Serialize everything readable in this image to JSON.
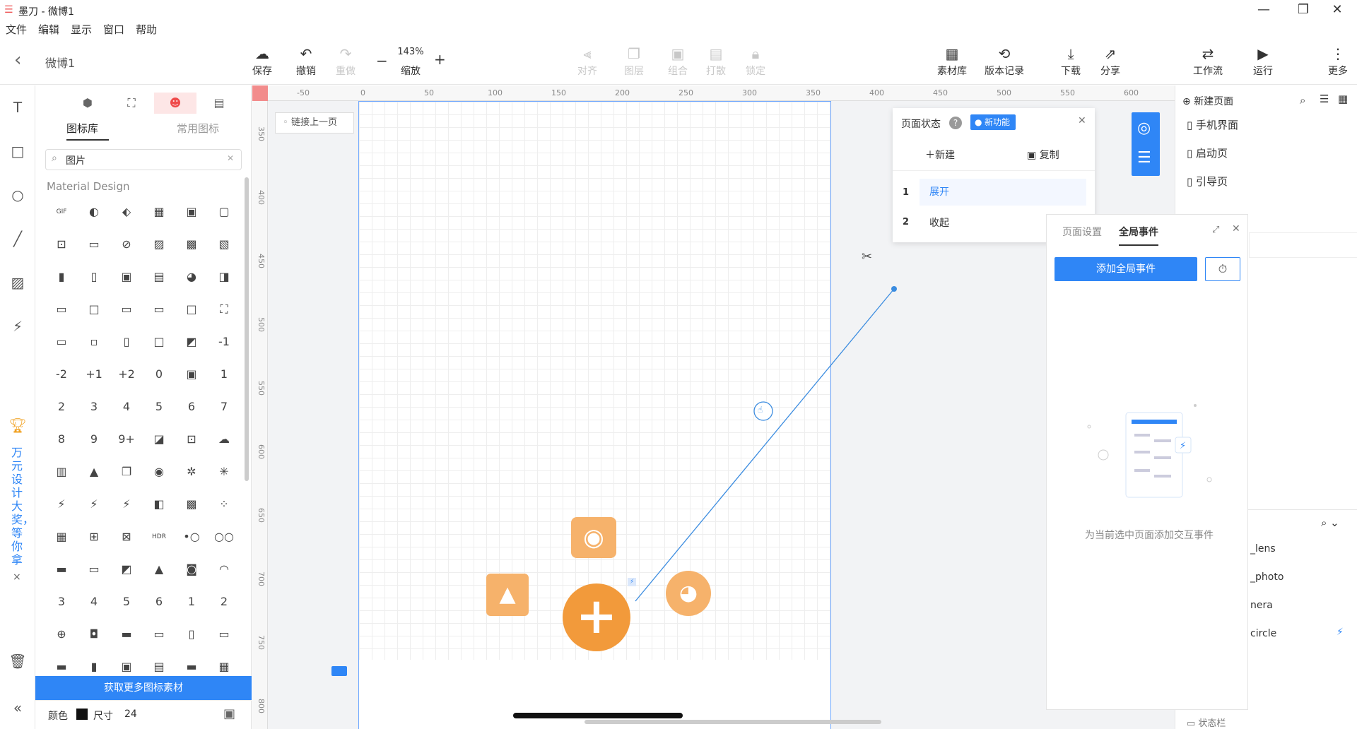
{
  "title_bar": {
    "title": "墨刀 - 微博1",
    "minimize": "—",
    "restore": "❐",
    "close": "✕"
  },
  "menu": [
    "文件",
    "编辑",
    "显示",
    "窗口",
    "帮助"
  ],
  "header": {
    "back": "‹",
    "doc_name": "微博1"
  },
  "toolbar": {
    "save": "保存",
    "undo": "撤销",
    "redo": "重做",
    "zoom_minus": "−",
    "zoom_value": "143%",
    "zoom_label": "缩放",
    "zoom_plus": "+",
    "align": "对齐",
    "layer": "图层",
    "group": "组合",
    "ungroup": "打散",
    "lock": "锁定",
    "assets": "素材库",
    "history": "版本记录",
    "download": "下载",
    "share": "分享",
    "workflow": "工作流",
    "run": "运行",
    "more": "更多"
  },
  "left_rail": {
    "promo": "万元设计大奖，等你拿",
    "promo_close": "×"
  },
  "icon_panel": {
    "tab_library": "图标库",
    "tab_common": "常用图标",
    "search_value": "图片",
    "search_clear": "✕",
    "section": "Material Design",
    "icons": [
      "GIF",
      "◐",
      "⬖",
      "▦",
      "▣",
      "▢",
      "⊡",
      "▭",
      "⊘",
      "▨",
      "▩",
      "▧",
      "▮",
      "▯",
      "▣",
      "▤",
      "◕",
      "◨",
      "▭",
      "□",
      "▭",
      "▭",
      "□",
      "⛶",
      "▭",
      "▫",
      "▯",
      "□",
      "◩",
      "-1",
      "-2",
      "+1",
      "+2",
      "0",
      "▣",
      "1",
      "2",
      "3",
      "4",
      "5",
      "6",
      "7",
      "8",
      "9",
      "9+",
      "◪",
      "⊡",
      "☁",
      "▥",
      "▲",
      "❐",
      "◉",
      "✲",
      "✳",
      "⚡",
      "⚡",
      "⚡",
      "◧",
      "▩",
      "⁘",
      "▦",
      "⊞",
      "⊠",
      "HDR",
      "•○",
      "○○",
      "▬",
      "▭",
      "◩",
      "▲",
      "◙",
      "◠",
      "3",
      "4",
      "5",
      "6",
      "1",
      "2",
      "⊕",
      "◘",
      "▬",
      "▭",
      "▯",
      "▭",
      "▬",
      "▮",
      "▣",
      "▤",
      "▬",
      "▦"
    ],
    "get_more": "获取更多图标素材",
    "color_label": "颜色",
    "size_label": "尺寸",
    "size_value": "24"
  },
  "canvas": {
    "link_prev": "链接上一页",
    "ruler_x": [
      "-50",
      "0",
      "50",
      "100",
      "150",
      "200",
      "250",
      "300",
      "350",
      "400",
      "450",
      "500",
      "550",
      "600"
    ],
    "ruler_y": [
      "350",
      "400",
      "450",
      "500",
      "550",
      "600",
      "650",
      "700",
      "750",
      "800"
    ]
  },
  "state_panel": {
    "title": "页面状态",
    "help": "?",
    "badge": "新功能",
    "close": "✕",
    "new": "新建",
    "copy": "复制",
    "states": [
      {
        "num": "1",
        "label": "展开"
      },
      {
        "num": "2",
        "label": "收起"
      }
    ]
  },
  "event_panel": {
    "tab_page": "页面设置",
    "tab_global": "全局事件",
    "add_button": "添加全局事件",
    "empty_text": "为当前选中页面添加交互事件"
  },
  "right_panel": {
    "new_page": "新建页面",
    "pages": [
      "手机界面",
      "启动页",
      "引导页"
    ],
    "layers": [
      "_lens",
      "_photo",
      "nera",
      "circle"
    ],
    "status_bar": "状态栏"
  },
  "colors": {
    "accent": "#2f86f6",
    "orange": "#f29a3b"
  }
}
